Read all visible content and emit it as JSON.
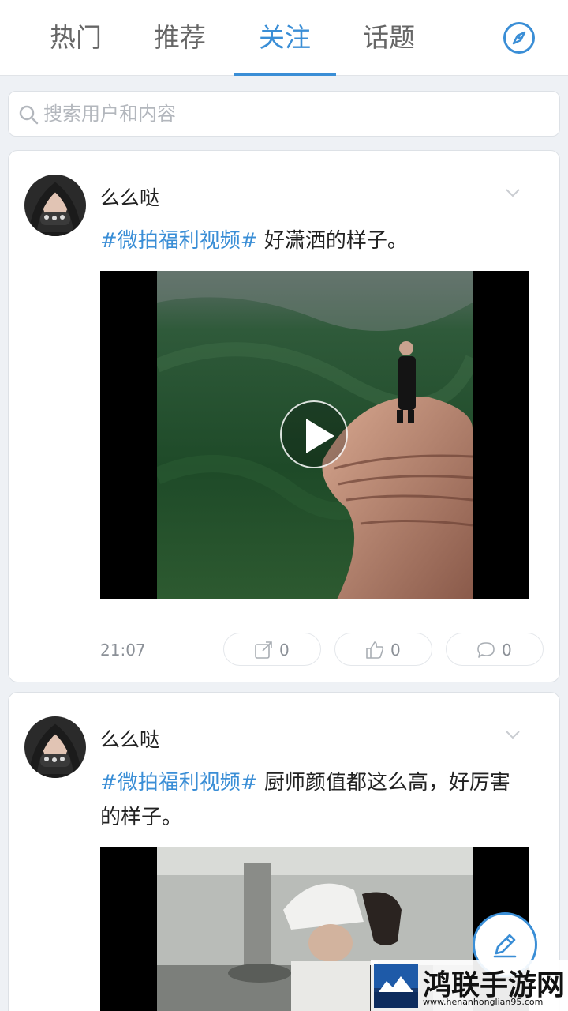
{
  "tabs": [
    {
      "label": "热门",
      "active": false
    },
    {
      "label": "推荐",
      "active": false
    },
    {
      "label": "关注",
      "active": true
    },
    {
      "label": "话题",
      "active": false
    }
  ],
  "header": {
    "right_icon": "compass-icon"
  },
  "search": {
    "placeholder": "搜索用户和内容",
    "icon": "search-icon"
  },
  "posts": [
    {
      "username": "么么哒",
      "hashtag": "#微拍福利视频#",
      "text": " 好潇洒的样子。",
      "time": "21:07",
      "share_count": "0",
      "like_count": "0",
      "comment_count": "0"
    },
    {
      "username": "么么哒",
      "hashtag": "#微拍福利视频#",
      "text": " 厨师颜值都这么高，好厉害的样子。"
    }
  ],
  "fab": {
    "icon": "pencil-icon"
  },
  "watermark": {
    "title": "鸿联手游网",
    "url": "www.henanhonglian95.com"
  },
  "colors": {
    "accent": "#3a8ed6",
    "background": "#eef1f5"
  }
}
